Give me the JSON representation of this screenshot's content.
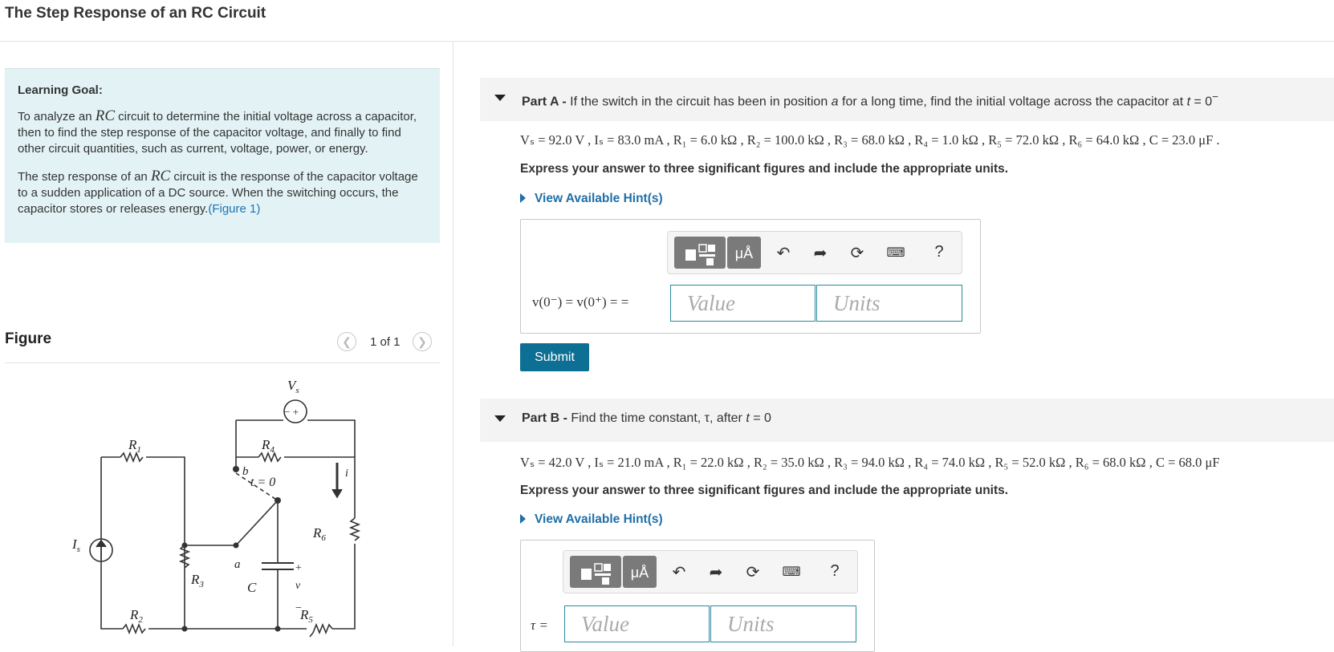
{
  "page": {
    "title": "The Step Response of an RC Circuit"
  },
  "learning_goal": {
    "heading": "Learning Goal:",
    "p1_before": "To analyze an ",
    "p1_math": "RC",
    "p1_after": " circuit to determine the initial voltage across a capacitor, then to find the step response of the capacitor voltage, and finally to find other circuit quantities, such as current, voltage, power, or energy.",
    "p2_before": "The step response of an ",
    "p2_math": "RC",
    "p2_after": " circuit is the response of the capacitor voltage to a sudden application of a DC source. When the switching occurs, the capacitor stores or releases energy.",
    "figure_link": "(Figure 1)"
  },
  "figure": {
    "label": "Figure",
    "pager": "1 of 1",
    "prev_icon": "chevron-left-icon",
    "next_icon": "chevron-right-icon",
    "circuit_labels": {
      "vs": "V",
      "vs_sub": "s",
      "sign": "− +",
      "r1": "R",
      "r1_sub": "1",
      "r2": "R",
      "r2_sub": "2",
      "r3": "R",
      "r3_sub": "3",
      "r4": "R",
      "r4_sub": "4",
      "r5": "R",
      "r5_sub": "5",
      "r6": "R",
      "r6_sub": "6",
      "is": "I",
      "is_sub": "s",
      "b": "b",
      "a": "a",
      "t0": "t = 0",
      "i": "i",
      "c": "C",
      "v": "v",
      "plus": "+",
      "minus": "−"
    }
  },
  "partA": {
    "label": "Part A -",
    "question_pre": " If the switch in the circuit has been in position ",
    "question_a": "a",
    "question_mid": " for a long time, find the initial voltage across the capacitor at ",
    "question_t": "t",
    "question_post": " = 0",
    "question_sup": "−",
    "given": "Vₛ = 92.0 V , Iₛ = 83.0 mA , R₁ = 6.0 kΩ , R₂ = 100.0 kΩ , R₃ = 68.0 kΩ , R₄ = 1.0 kΩ , R₅ = 72.0 kΩ , R₆ = 64.0 kΩ , C = 23.0 μF .",
    "instruction": "Express your answer to three significant figures and include the appropriate units.",
    "hint": "View Available Hint(s)",
    "equation": "v(0⁻) = v(0⁺) = =",
    "value_placeholder": "Value",
    "units_placeholder": "Units",
    "submit": "Submit"
  },
  "partB": {
    "label": "Part B -",
    "question_pre": " Find the time constant, τ, after ",
    "question_t": "t",
    "question_post": " = 0",
    "given": "Vₛ = 42.0 V , Iₛ = 21.0 mA , R₁ = 22.0 kΩ , R₂ = 35.0 kΩ , R₃ = 94.0 kΩ , R₄ = 74.0 kΩ , R₅ = 52.0 kΩ , R₆ = 68.0 kΩ , C = 68.0 μF",
    "instruction": "Express your answer to three significant figures and include the appropriate units.",
    "hint": "View Available Hint(s)",
    "equation": "τ =",
    "value_placeholder": "Value",
    "units_placeholder": "Units"
  },
  "toolbar": {
    "templates_icon": "templates-icon",
    "units_label": "μÅ",
    "undo_icon": "undo-icon",
    "redo_icon": "redo-icon",
    "reset_icon": "reset-icon",
    "keyboard_icon": "keyboard-icon",
    "help_label": "?"
  }
}
